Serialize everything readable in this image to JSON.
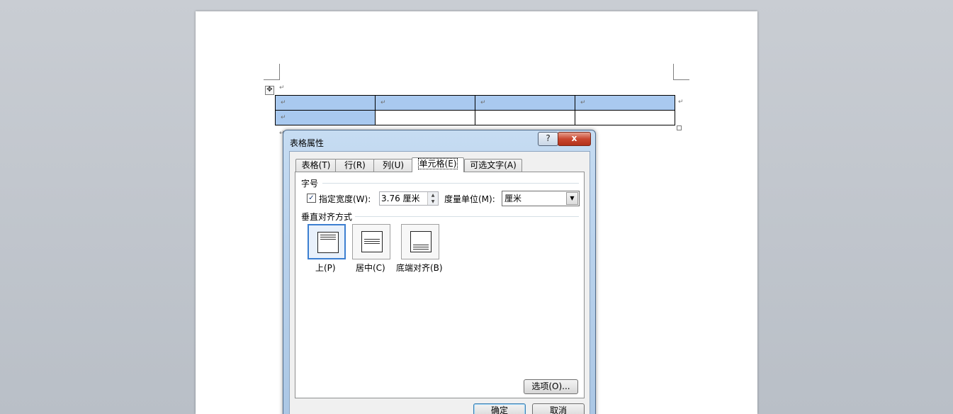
{
  "document": {
    "paragraph_mark": "↵",
    "move_handle_icon": "move-arrows-icon",
    "table": {
      "rows": [
        [
          "↵",
          "↵",
          "↵",
          "↵"
        ],
        [
          "↵",
          "",
          "",
          ""
        ]
      ],
      "row_end_mark": "↵",
      "selection_color": "#a9c9ef"
    }
  },
  "dialog": {
    "title": "表格属性",
    "help_label": "?",
    "close_label": "x",
    "tabs": [
      {
        "label": "表格(T)",
        "active": false
      },
      {
        "label": "行(R)",
        "active": false
      },
      {
        "label": "列(U)",
        "active": false
      },
      {
        "label": "单元格(E)",
        "active": true
      },
      {
        "label": "可选文字(A)",
        "active": false
      }
    ],
    "size_group": {
      "label": "字号",
      "checkbox_checked": true,
      "check_glyph": "✓",
      "width_label": "指定宽度(W):",
      "width_value": "3.76 厘米",
      "unit_label": "度量单位(M):",
      "unit_value": "厘米"
    },
    "vertical_align": {
      "label": "垂直对齐方式",
      "options": [
        {
          "label": "上(P)",
          "selected": true
        },
        {
          "label": "居中(C)",
          "selected": false
        },
        {
          "label": "底端对齐(B)",
          "selected": false
        }
      ]
    },
    "options_button": "选项(O)...",
    "ok_button": "确定",
    "cancel_button": "取消",
    "accent_color": "#3c7fd1"
  }
}
